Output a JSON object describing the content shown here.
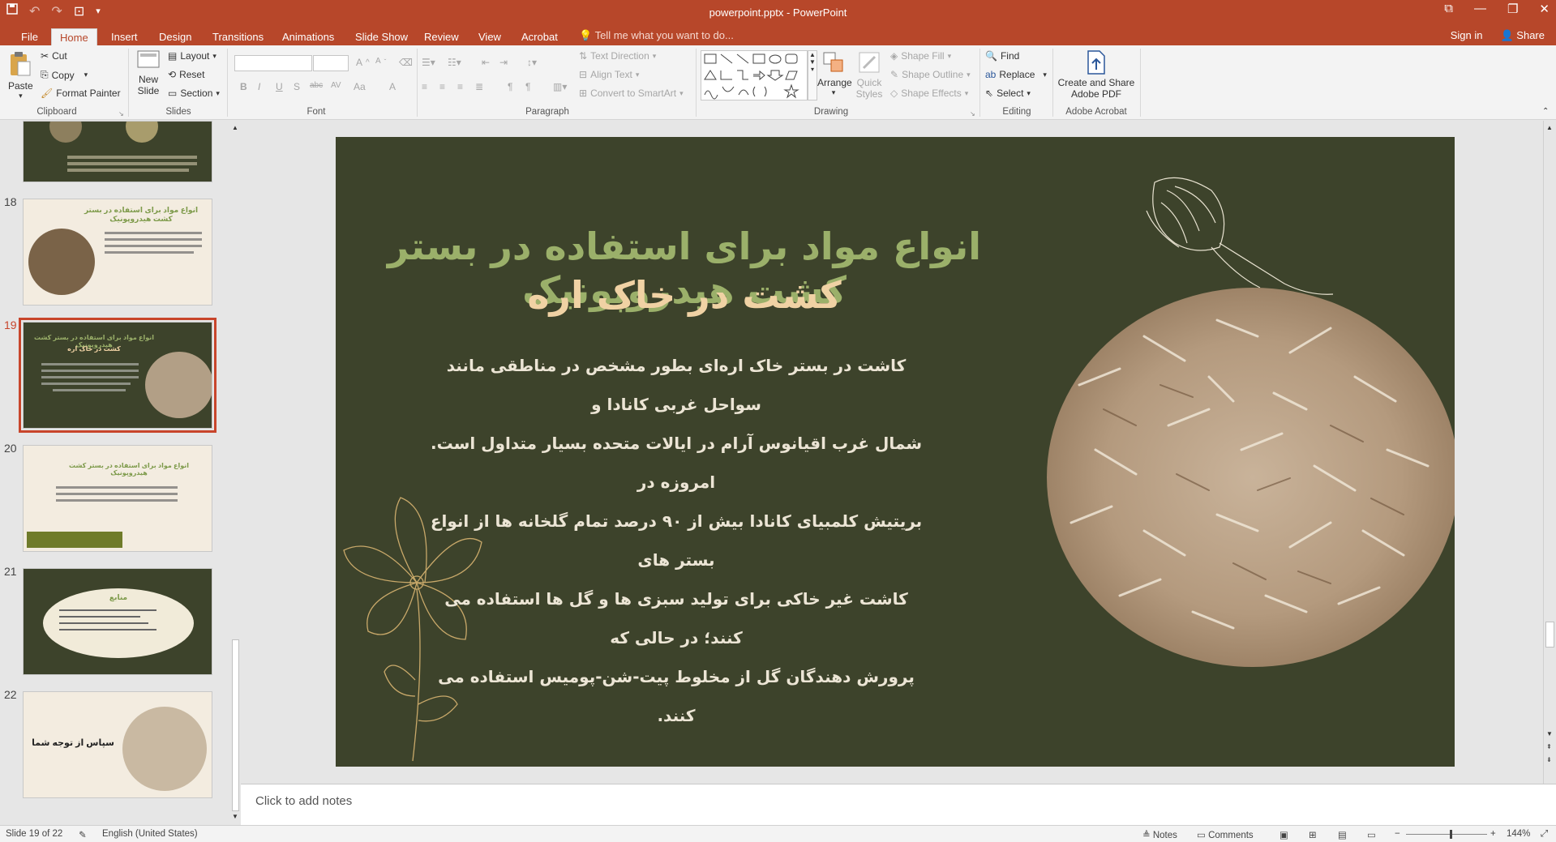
{
  "window": {
    "title": "powerpoint.pptx - PowerPoint",
    "controls": [
      "restore",
      "minimize",
      "maximize",
      "close"
    ]
  },
  "tabs": [
    {
      "label": "File"
    },
    {
      "label": "Home",
      "active": true
    },
    {
      "label": "Insert"
    },
    {
      "label": "Design"
    },
    {
      "label": "Transitions"
    },
    {
      "label": "Animations"
    },
    {
      "label": "Slide Show"
    },
    {
      "label": "Review"
    },
    {
      "label": "View"
    },
    {
      "label": "Acrobat"
    }
  ],
  "tell_me": "Tell me what you want to do...",
  "account": {
    "sign_in": "Sign in",
    "share": "Share"
  },
  "ribbon": {
    "clipboard": {
      "paste": "Paste",
      "cut": "Cut",
      "copy": "Copy",
      "format_painter": "Format Painter",
      "label": "Clipboard"
    },
    "slides": {
      "new_slide_1": "New",
      "new_slide_2": "Slide",
      "layout": "Layout",
      "reset": "Reset",
      "section": "Section",
      "label": "Slides"
    },
    "font": {
      "label": "Font",
      "bold": "B",
      "italic": "I",
      "underline": "U",
      "strike": "S",
      "shadow": "abc",
      "spacing": "AV",
      "case": "Aa",
      "color": "A",
      "grow": "A",
      "shrink": "A"
    },
    "paragraph": {
      "label": "Paragraph",
      "text_direction": "Text Direction",
      "align_text": "Align Text",
      "convert": "Convert to SmartArt"
    },
    "drawing": {
      "label": "Drawing",
      "arrange": "Arrange",
      "quick_styles_1": "Quick",
      "quick_styles_2": "Styles",
      "shape_fill": "Shape Fill",
      "shape_outline": "Shape Outline",
      "shape_effects": "Shape Effects"
    },
    "editing": {
      "label": "Editing",
      "find": "Find",
      "replace": "Replace",
      "select": "Select"
    },
    "acrobat": {
      "label": "Adobe Acrobat",
      "create_1": "Create and Share",
      "create_2": "Adobe PDF"
    }
  },
  "thumbnails": [
    {
      "number": "",
      "theme": "dark"
    },
    {
      "number": "18",
      "theme": "light",
      "title": "انواع مواد برای استفاده در بستر کشت هیدروپونیک"
    },
    {
      "number": "19",
      "theme": "dark",
      "title": "انواع مواد برای استفاده در بستر کشت هیدروپونیک",
      "subtitle": "کشت در خاک اره",
      "selected": true
    },
    {
      "number": "20",
      "theme": "light",
      "title": "انواع مواد برای استفاده در بستر کشت هیدروپونیک"
    },
    {
      "number": "21",
      "theme": "dark",
      "title": "منابع"
    },
    {
      "number": "22",
      "theme": "light",
      "title": "سپاس از توجه شما"
    }
  ],
  "slide": {
    "title_line1": "انواع مواد برای استفاده در بستر کشت هیدروپونیک",
    "title_line2": "کشت در خاک اره",
    "body_lines": [
      "کاشت در بستر خاک اره‌ای بطور مشخص در مناطقی مانند سواحل غربی کانادا و",
      "شمال غرب اقیانوس آرام در ایالات متحده بسیار متداول است. امروزه در",
      "بریتیش کلمبیای کانادا بیش از ۹۰ درصد تمام گلخانه ها از انواع بستر های",
      "کاشت غیر خاکی برای تولید سبزی ها و گل ها استفاده می کنند؛ در حالی که",
      "پرورش دهندگان گل از مخلوط پیت-شن-پومیس استفاده می کنند."
    ],
    "colors": {
      "background": "#3d432b",
      "title1": "#9bb06a",
      "title2": "#f0d2a4",
      "body": "#ece5d5"
    }
  },
  "notes": {
    "placeholder": "Click to add notes"
  },
  "status": {
    "slide_counter": "Slide 19 of 22",
    "language": "English (United States)",
    "notes": "Notes",
    "comments": "Comments",
    "zoom": "144%"
  }
}
